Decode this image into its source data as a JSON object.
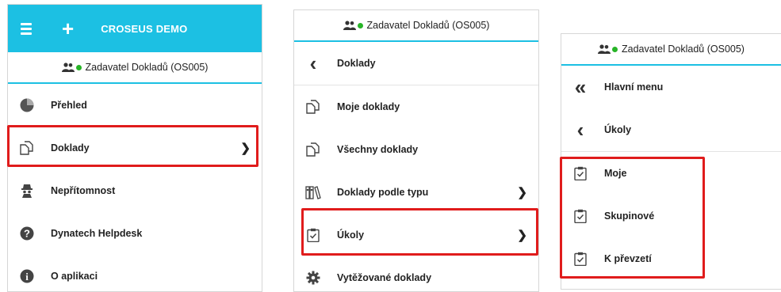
{
  "panel1": {
    "app_title": "CROSEUS DEMO",
    "user_label": "Zadavatel Dokladů (OS005)",
    "items": [
      {
        "label": "Přehled",
        "icon": "pie-chart-icon"
      },
      {
        "label": "Doklady",
        "icon": "documents-icon"
      },
      {
        "label": "Nepřítomnost",
        "icon": "spy-icon"
      },
      {
        "label": "Dynatech Helpdesk",
        "icon": "question-icon"
      },
      {
        "label": "O aplikaci",
        "icon": "info-icon"
      }
    ]
  },
  "panel2": {
    "user_label": "Zadavatel Dokladů (OS005)",
    "back_label": "Doklady",
    "items": [
      {
        "label": "Moje doklady",
        "icon": "documents-icon"
      },
      {
        "label": "Všechny doklady",
        "icon": "documents-icon"
      },
      {
        "label": "Doklady podle typu",
        "icon": "binders-icon"
      },
      {
        "label": "Úkoly",
        "icon": "clipboard-check-icon"
      },
      {
        "label": "Vytěžované doklady",
        "icon": "gear-icon"
      }
    ]
  },
  "panel3": {
    "user_label": "Zadavatel Dokladů (OS005)",
    "main_menu_label": "Hlavní menu",
    "back_label": "Úkoly",
    "items": [
      {
        "label": "Moje",
        "icon": "clipboard-check-icon"
      },
      {
        "label": "Skupinové",
        "icon": "clipboard-check-icon"
      },
      {
        "label": "K převzetí",
        "icon": "clipboard-check-icon"
      }
    ]
  },
  "colors": {
    "accent": "#1cc0e3",
    "highlight": "#e01c1c",
    "online": "#27b427"
  }
}
